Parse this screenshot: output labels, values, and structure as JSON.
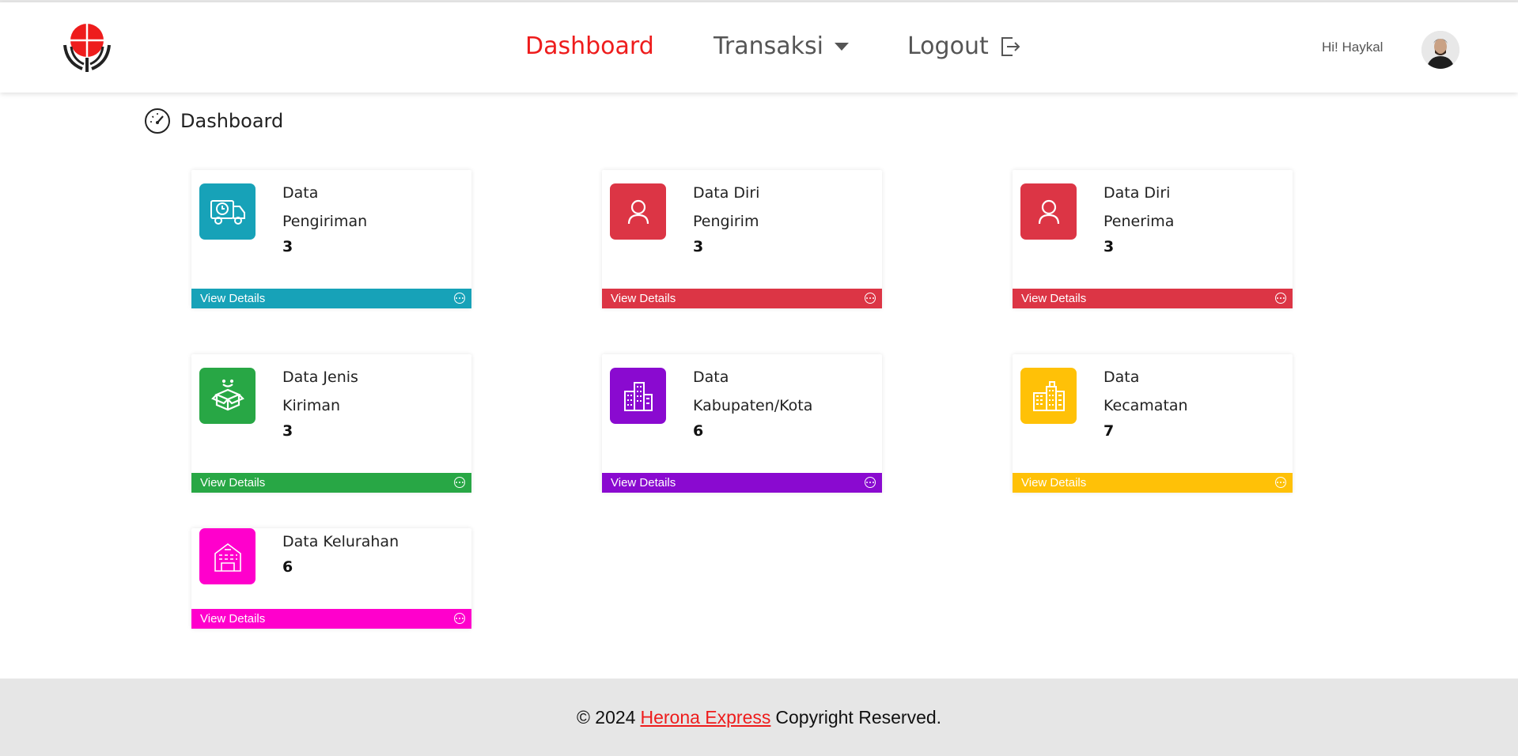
{
  "nav": {
    "links": [
      "Dashboard",
      "Transaksi",
      "Logout"
    ],
    "greeting": "Hi! Haykal",
    "accent": "#ee1c1c"
  },
  "page": {
    "title": "Dashboard"
  },
  "cards": [
    {
      "line1": "Data",
      "line2": "Pengiriman",
      "value": "3",
      "footer": "View Details",
      "color": "#17a2b8",
      "icon": "truck-clock-icon"
    },
    {
      "line1": "Data Diri",
      "line2": "Pengirim",
      "value": "3",
      "footer": "View Details",
      "color": "#dc3545",
      "icon": "user-icon"
    },
    {
      "line1": "Data Diri",
      "line2": "Penerima",
      "value": "3",
      "footer": "View Details",
      "color": "#dc3545",
      "icon": "user-icon"
    },
    {
      "line1": "Data Jenis",
      "line2": "Kiriman",
      "value": "3",
      "footer": "View Details",
      "color": "#28a745",
      "icon": "open-box-icon"
    },
    {
      "line1": "Data",
      "line2": "Kabupaten/Kota",
      "value": "6",
      "footer": "View Details",
      "color": "#8a0ad0",
      "icon": "city-buildings-icon"
    },
    {
      "line1": "Data",
      "line2": "Kecamatan",
      "value": "7",
      "footer": "View Details",
      "color": "#ffc107",
      "icon": "office-buildings-icon"
    },
    {
      "line1": "Data Kelurahan",
      "line2": "",
      "value": "6",
      "footer": "View Details",
      "color": "#ff00cc",
      "icon": "hotel-building-icon"
    }
  ],
  "footer": {
    "prefix": "© 2024",
    "brand": "Herona Express",
    "suffix": "Copyright Reserved."
  }
}
